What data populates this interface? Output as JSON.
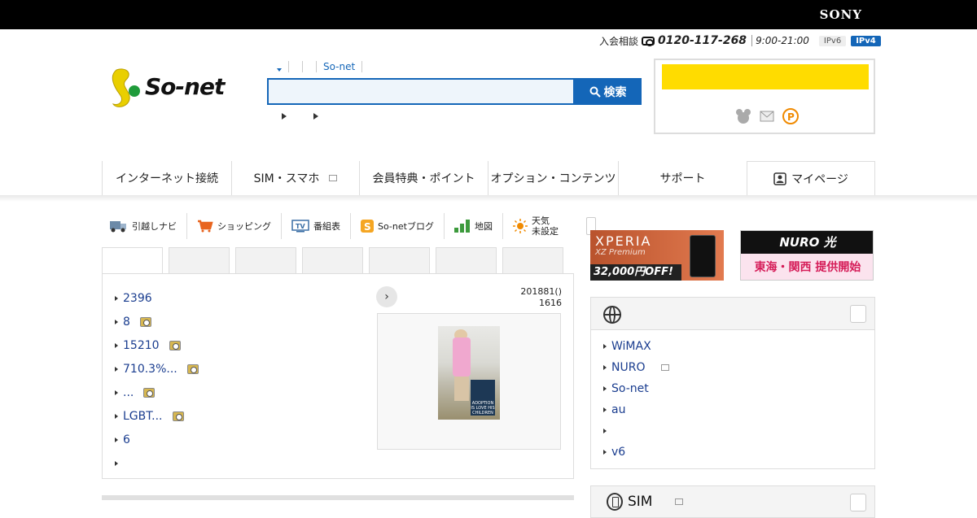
{
  "brand": {
    "sony": "SONY",
    "sonet": "So-net"
  },
  "contact": {
    "label": "入会相談",
    "phone": "0120-117-268",
    "hours": "9:00-21:00",
    "ipv6": "IPv6",
    "ipv4": "IPv4"
  },
  "search": {
    "tab_sonet": "So-net",
    "button_label": "検索",
    "placeholder": ""
  },
  "login": {
    "button_label": ""
  },
  "global_nav": [
    {
      "label": "インターネット接続"
    },
    {
      "label": "SIM・スマホ"
    },
    {
      "label": "会員特典・ポイント"
    },
    {
      "label": "オプション・コンテンツ"
    },
    {
      "label": "サポート"
    },
    {
      "label": "マイページ"
    }
  ],
  "services": [
    {
      "label": "引越しナビ",
      "icon": "truck-icon",
      "color": "#6c8aa8"
    },
    {
      "label": "ショッピング",
      "icon": "cart-icon",
      "color": "#e8641e"
    },
    {
      "label": "番組表",
      "icon": "tv-icon",
      "color": "#3a6ea5"
    },
    {
      "label": "So-netブログ",
      "icon": "blog-icon",
      "color": "#f5a623"
    },
    {
      "label": "地図",
      "icon": "map-icon",
      "color": "#3c9a3c"
    },
    {
      "label": "天気",
      "icon": "sun-icon",
      "color": "#f08a00"
    },
    {
      "label": "未設定"
    }
  ],
  "news": {
    "items": [
      {
        "text": "2396",
        "camera": false
      },
      {
        "text": "8",
        "camera": true
      },
      {
        "text": "15210",
        "camera": true
      },
      {
        "text": "710.3%...",
        "camera": true
      },
      {
        "text": "...",
        "camera": true
      },
      {
        "text": "LGBT...",
        "camera": true
      },
      {
        "text": "6",
        "camera": false
      },
      {
        "text": "",
        "camera": false
      }
    ],
    "date_line1": "201881()",
    "date_line2": "1616",
    "photo_caption": "ADOPTION IS LOVE HIS CHILDREN"
  },
  "ads": {
    "xperia": {
      "title": "XPERIA",
      "model": "XZ Premium",
      "offer": "32,000円OFF!"
    },
    "nuro": {
      "title": "NURO 光",
      "sub": "東海・関西 提供開始"
    }
  },
  "internet": {
    "items": [
      "WiMAX",
      "NURO",
      "So-net",
      "au",
      "",
      "v6"
    ]
  },
  "sim": {
    "title": "SIM"
  },
  "colors": {
    "accent": "#1466b8",
    "login_yellow": "#ffdc00",
    "link": "#1a3d8f"
  }
}
